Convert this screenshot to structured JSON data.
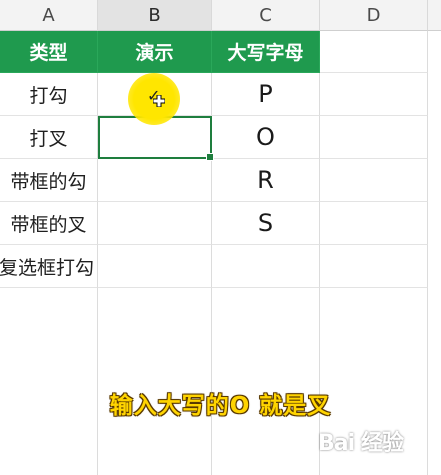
{
  "columns": [
    "A",
    "B",
    "C",
    "D"
  ],
  "active_column": "B",
  "table": {
    "headers": [
      "类型",
      "演示",
      "大写字母"
    ],
    "rows": [
      {
        "type": "打勾",
        "demo": "✓",
        "letter": "P"
      },
      {
        "type": "打叉",
        "demo": "",
        "letter": "O"
      },
      {
        "type": "带框的勾",
        "demo": "",
        "letter": "R"
      },
      {
        "type": "带框的叉",
        "demo": "",
        "letter": "S"
      },
      {
        "type": "复选框打勾",
        "demo": "",
        "letter": ""
      }
    ]
  },
  "caption": "输入大写的O 就是叉",
  "watermark": "Bai 经验",
  "colors": {
    "header_green": "#1f9a4e",
    "selection": "#1e7e3e",
    "caption": "#ffd400",
    "highlight": "#ffe600"
  }
}
